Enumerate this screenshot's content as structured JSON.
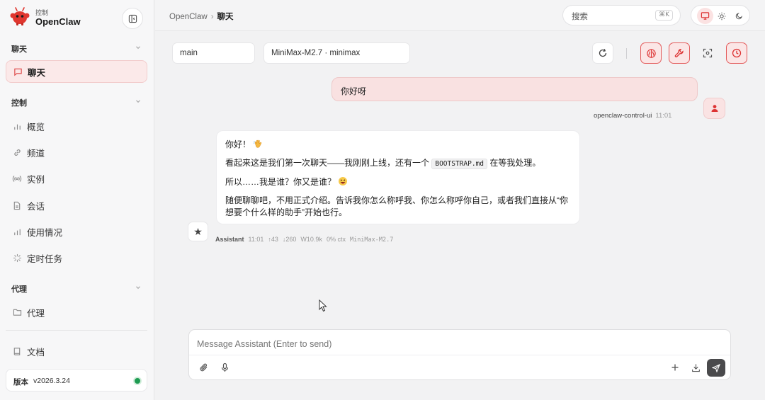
{
  "sidebar": {
    "brand_sub": "控制",
    "brand_name": "OpenClaw",
    "sections": {
      "chat": {
        "title": "聊天",
        "items": [
          {
            "label": "聊天",
            "icon": "message-square-icon"
          }
        ]
      },
      "control": {
        "title": "控制",
        "items": [
          {
            "label": "概览",
            "icon": "bar-chart-icon"
          },
          {
            "label": "频道",
            "icon": "link-icon"
          },
          {
            "label": "实例",
            "icon": "radio-icon"
          },
          {
            "label": "会话",
            "icon": "file-text-icon"
          },
          {
            "label": "使用情况",
            "icon": "bar-chart-icon"
          },
          {
            "label": "定时任务",
            "icon": "loader-icon"
          }
        ]
      },
      "agent": {
        "title": "代理",
        "items": [
          {
            "label": "代理",
            "icon": "folder-icon"
          }
        ]
      }
    },
    "docs_label": "文档",
    "version_label": "版本",
    "version_value": "v2026.3.24",
    "status_color": "#1e9b52"
  },
  "topbar": {
    "breadcrumb_root": "OpenClaw",
    "breadcrumb_current": "聊天",
    "search_placeholder": "搜索",
    "search_shortcut": "⌘K"
  },
  "toolbar": {
    "session": "main",
    "model": "MiniMax-M2.7 · minimax"
  },
  "messages": {
    "user": {
      "text": "你好呀",
      "sender": "openclaw-control-ui",
      "time": "11:01"
    },
    "assistant": {
      "line1": "你好！",
      "line2_before": "看起来这是我们第一次聊天——我刚刚上线，还有一个",
      "line2_code": "BOOTSTRAP.md",
      "line2_after": "在等我处理。",
      "line3": "所以……我是谁？你又是谁？",
      "line4": "随便聊聊吧，不用正式介绍。告诉我你怎么称呼我、你怎么称呼你自己，或者我们直接从“你想要个什么样的助手”开始也行。",
      "sender": "Assistant",
      "time": "11:01",
      "stat_in": "↑43",
      "stat_out": "↓260",
      "stat_w": "W10.9k",
      "stat_ctx": "0% ctx",
      "model": "MiniMax-M2.7"
    }
  },
  "composer": {
    "placeholder": "Message Assistant (Enter to send)"
  },
  "colors": {
    "accent": "#e35b5b",
    "accent_bg": "#fbe6e6"
  }
}
